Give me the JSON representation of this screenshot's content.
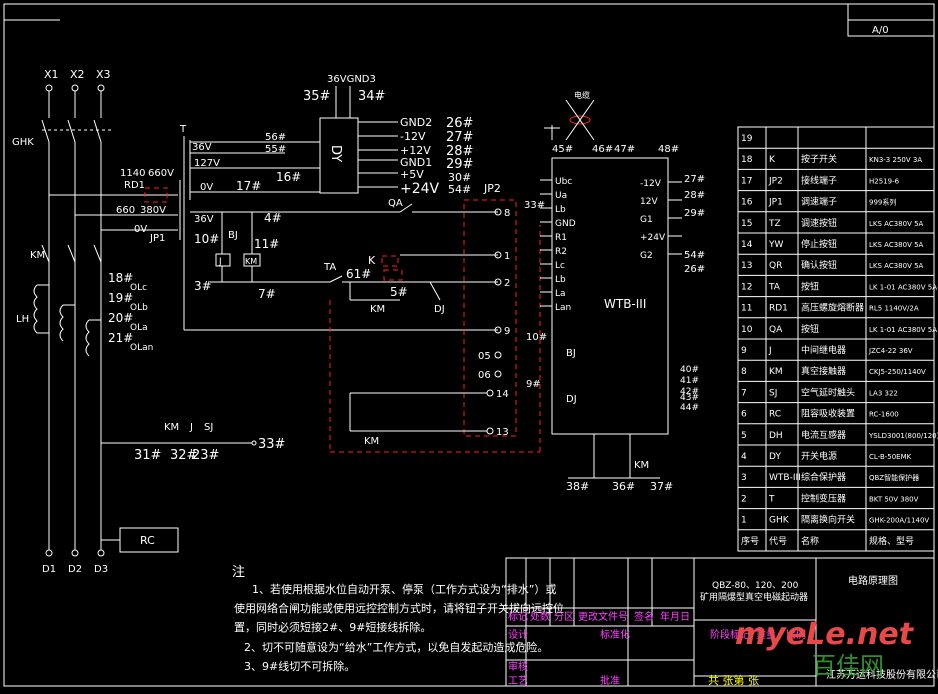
{
  "title_corner": {
    "left_stamp": "",
    "rev_label": "A/0"
  },
  "top": {
    "gnd_label": "36VGND3",
    "t35": "35#",
    "t34": "34#",
    "dy": "DY",
    "wire_label": "电缆"
  },
  "isolator": {
    "x1": "X1",
    "x2": "X2",
    "x3": "X3",
    "ghk": "GHK",
    "km": "KM",
    "lh": "LH",
    "d1": "D1",
    "d2": "D2",
    "d3": "D3"
  },
  "transformer": {
    "t": "T",
    "v36": "36V",
    "v127": "127V",
    "v0": "0V",
    "v1140": "1140",
    "v660": "660V",
    "v660b": "660",
    "v380": "380V",
    "v0b": "0V",
    "v36b": "36V",
    "rd1": "RD1",
    "jp1": "JP1",
    "n56": "56#",
    "n55": "55#",
    "n17": "17#",
    "n16": "16#"
  },
  "power_out": {
    "gnd2": "GND2",
    "m12": "-12V",
    "p12": "+12V",
    "gnd1": "GND1",
    "p5": "+5V",
    "p24": "+24V",
    "n26": "26#",
    "n27": "27#",
    "n28": "28#",
    "n29": "29#",
    "n30": "30#",
    "n54": "54#"
  },
  "control": {
    "n4": "4#",
    "n10": "10#",
    "n11": "11#",
    "n3": "3#",
    "n7": "7#",
    "n61": "61#",
    "n5": "5#",
    "bj": "BJ",
    "j": "J",
    "km": "KM",
    "ta": "TA",
    "k": "K",
    "qa": "QA",
    "dj": "DJ",
    "km2": "KM"
  },
  "current": {
    "n18": "18#",
    "n19": "19#",
    "n20": "20#",
    "n21": "21#",
    "lc": "OLc",
    "lb": "OLb",
    "la": "OLa",
    "lan": "OLan"
  },
  "bottom": {
    "km": "KM",
    "j": "J",
    "sj": "SJ",
    "n31": "31#",
    "n32": "32#",
    "n23": "23#",
    "n33": "33#",
    "rc": "RC"
  },
  "jp2": {
    "label": "JP2",
    "p8": "8",
    "p1": "1",
    "p2": "2",
    "p9": "9",
    "p05": "05",
    "p06": "06",
    "p14": "14",
    "p13": "13"
  },
  "wtb": {
    "label": "WTB-III",
    "n45": "45#",
    "n46": "46#",
    "n47": "47#",
    "n48": "48#",
    "n33": "33#",
    "n58": "58#",
    "n59": "59#",
    "n10": "10#",
    "n9": "9#",
    "n1": "1#",
    "n4": "4#",
    "left_pins": [
      "Ubc",
      "Ua",
      "Lb",
      "GND",
      "R1",
      "R2",
      "Lc",
      "Lb",
      "La",
      "Lan"
    ],
    "right_pins": [
      "-12V",
      "12V",
      "G1",
      "+24V",
      "G2"
    ],
    "r27": "27#",
    "r28": "28#",
    "r29": "29#",
    "r54": "54#",
    "r26": "26#",
    "bj": "BJ",
    "dj": "DJ",
    "km": "KM",
    "n38": "38#",
    "n36": "36#",
    "n37": "37#",
    "n40": "40#",
    "n41": "41#",
    "n42": "42#",
    "n43": "43#",
    "n44": "44#"
  },
  "parts_table": {
    "header": [
      "序号",
      "代号",
      "名称",
      "规格、型号"
    ],
    "rows": [
      [
        "19",
        "",
        "",
        ""
      ],
      [
        "18",
        "K",
        "按子开关",
        "KN3-3 250V 3A"
      ],
      [
        "17",
        "JP2",
        "接线端子",
        "H2519-6"
      ],
      [
        "16",
        "JP1",
        "调速端子",
        "999系列"
      ],
      [
        "15",
        "TZ",
        "调速按钮",
        "LKS AC380V 5A"
      ],
      [
        "14",
        "YW",
        "停止按钮",
        "LKS AC380V 5A"
      ],
      [
        "13",
        "QR",
        "确认按钮",
        "LKS AC380V 5A"
      ],
      [
        "12",
        "TA",
        "按钮",
        "LK 1-01 AC380V 5A"
      ],
      [
        "11",
        "RD1",
        "高压螺旋熔断器",
        "RL5 1140V/2A"
      ],
      [
        "10",
        "QA",
        "按钮",
        "LK 1-01 AC380V 5A"
      ],
      [
        "9",
        "J",
        "中间继电器",
        "JZC4-22 36V"
      ],
      [
        "8",
        "KM",
        "真空接触器",
        "CKJ5-250/1140V"
      ],
      [
        "7",
        "SJ",
        "空气延时触头",
        "LA3 322"
      ],
      [
        "6",
        "RC",
        "阻容吸收装置",
        "RC-1600"
      ],
      [
        "5",
        "DH",
        "电流互感器",
        "YSLD3001(800/120)"
      ],
      [
        "4",
        "DY",
        "开关电源",
        "CL-B-50EMK"
      ],
      [
        "3",
        "WTB-III",
        "综合保护器",
        "QBZ智能保护器"
      ],
      [
        "2",
        "T",
        "控制变压器",
        "BKT 50V 380V"
      ],
      [
        "1",
        "GHK",
        "隔离换向开关",
        "GHK-200A/1140V"
      ]
    ]
  },
  "notes": {
    "head": "注",
    "l1": "1、若使用根据水位自动开泵、停泵（工作方式设为“排水”）或",
    "l2": "使用网络合闸功能或使用远控控制方式时，请将钮子开关拔向远控位",
    "l3": "置，同时必须短接2#、9#短接线拆除。",
    "l4": "2、切不可随意设为“给水”工作方式，以免自发起动造成危险。",
    "l5": "3、9#线切不可拆除。"
  },
  "title_block": {
    "product": "QBZ-80、120、200",
    "product2": "矿用隔爆型真空电磁起动器",
    "drawing": "电路原理图",
    "mark": "标记",
    "count": "处数",
    "zone": "分区",
    "doc": "更改文件号",
    "sign": "签名",
    "date": "年月日",
    "design": "设计",
    "std": "标准化",
    "stage": "阶段标记",
    "weight": "重量",
    "ratio": "比例",
    "review": "审核",
    "process": "工艺",
    "approve": "批准",
    "sheets": "共  张第  张",
    "company": "江苏万运科技股份有限公司"
  },
  "watermark": {
    "site": "myeLe.net",
    "cn": "百佳网"
  }
}
